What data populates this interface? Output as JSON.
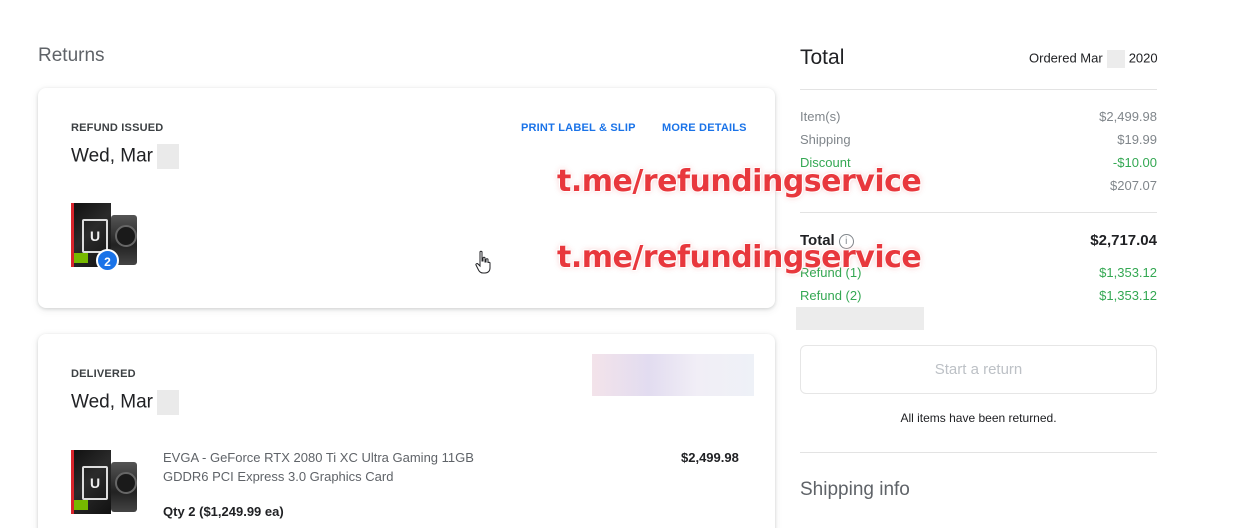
{
  "returns": {
    "title": "Returns",
    "refund_card": {
      "status": "REFUND ISSUED",
      "date": "Wed, Mar",
      "actions": {
        "print_label": "PRINT LABEL & SLIP",
        "more_details": "MORE DETAILS"
      },
      "item_count_badge": "2"
    },
    "delivered_card": {
      "status": "DELIVERED",
      "date": "Wed, Mar",
      "item": {
        "name": "EVGA - GeForce RTX 2080 Ti XC Ultra Gaming 11GB GDDR6 PCI Express 3.0 Graphics Card",
        "price": "$2,499.98",
        "qty": "Qty 2 ($1,249.99 ea)"
      }
    }
  },
  "summary": {
    "title": "Total",
    "ordered_prefix": "Ordered Mar",
    "ordered_year": "2020",
    "lines": [
      {
        "label": "Item(s)",
        "value": "$2,499.98"
      },
      {
        "label": "Shipping",
        "value": "$19.99"
      },
      {
        "label": "Discount",
        "value": "-$10.00"
      },
      {
        "label": "",
        "value": "$207.07"
      }
    ],
    "total_label": "Total",
    "total_value": "$2,717.04",
    "refunds": [
      {
        "label": "Refund (1)",
        "value": "$1,353.12"
      },
      {
        "label": "Refund (2)",
        "value": "$1,353.12"
      }
    ],
    "start_return_label": "Start a return",
    "returned_note": "All items have been returned.",
    "shipping_info": "Shipping info"
  },
  "overlay": {
    "watermark_1": "t.me/refundingservice",
    "watermark_2": "t.me/refundingservice"
  },
  "colors": {
    "link": "#1a73e8",
    "refund_green": "#34a853",
    "watermark": "#e8383d"
  }
}
